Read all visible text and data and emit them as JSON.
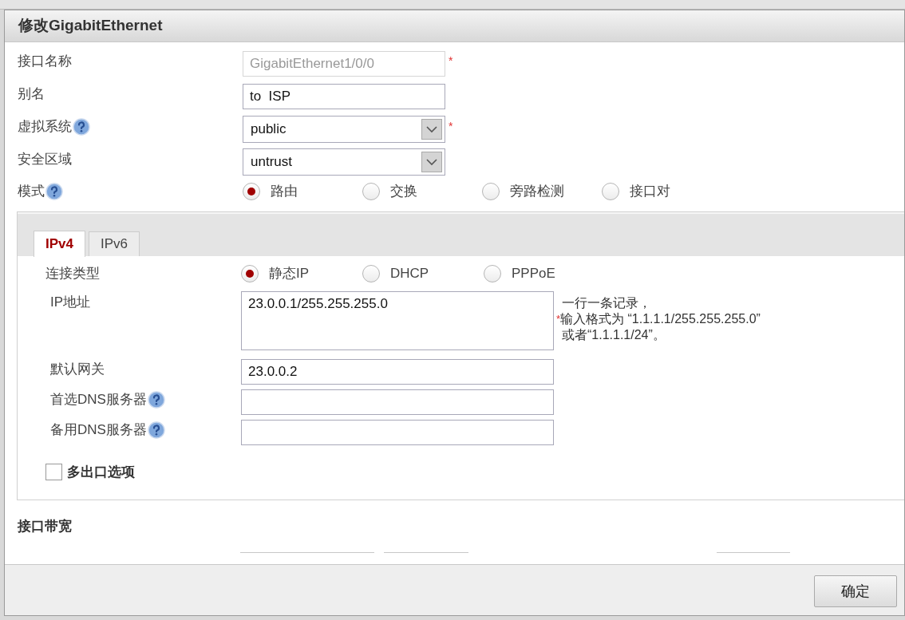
{
  "dialog": {
    "title": "修改GigabitEthernet"
  },
  "required_mark": "*",
  "fields": [
    {
      "kind": "text",
      "label": "接口名称",
      "value": "GigabitEthernet1/0/0",
      "disabled": true,
      "required": true,
      "help": false
    },
    {
      "kind": "text",
      "label": "别名",
      "value": "to  ISP",
      "disabled": false,
      "required": false,
      "help": false
    },
    {
      "kind": "select",
      "label": "虚拟系统",
      "value": "public",
      "required": true,
      "help": true
    },
    {
      "kind": "select",
      "label": "安全区域",
      "value": "untrust",
      "required": false,
      "help": false
    }
  ],
  "mode": {
    "label": "模式",
    "help": true,
    "options": [
      {
        "label": "路由",
        "selected": true
      },
      {
        "label": "交换",
        "selected": false
      },
      {
        "label": "旁路检测",
        "selected": false
      },
      {
        "label": "接口对",
        "selected": false
      }
    ]
  },
  "tabs": [
    {
      "label": "IPv4",
      "selected": true
    },
    {
      "label": "IPv6",
      "selected": false
    }
  ],
  "connection_type": {
    "label": "连接类型",
    "options": [
      {
        "label": "静态IP",
        "selected": true
      },
      {
        "label": "DHCP",
        "selected": false
      },
      {
        "label": "PPPoE",
        "selected": false
      }
    ]
  },
  "ip_address": {
    "label": "IP地址",
    "value": "23.0.0.1/255.255.255.0",
    "hint": [
      {
        "text": "一行一条记录，",
        "required": false
      },
      {
        "text": "输入格式为 “1.1.1.1/255.255.255.0”",
        "required": true
      },
      {
        "text": "或者“1.1.1.1/24”。",
        "required": false
      }
    ]
  },
  "ip_fields": [
    {
      "label": "默认网关",
      "value": "23.0.0.2",
      "help": false
    },
    {
      "label": "首选DNS服务器",
      "help": true
    },
    {
      "label": "备用DNS服务器",
      "help": true
    }
  ],
  "multi_exit": {
    "label": "多出口选项",
    "checked": false
  },
  "bandwidth_section": {
    "title": "接口带宽"
  },
  "buttons": [
    "确定"
  ]
}
